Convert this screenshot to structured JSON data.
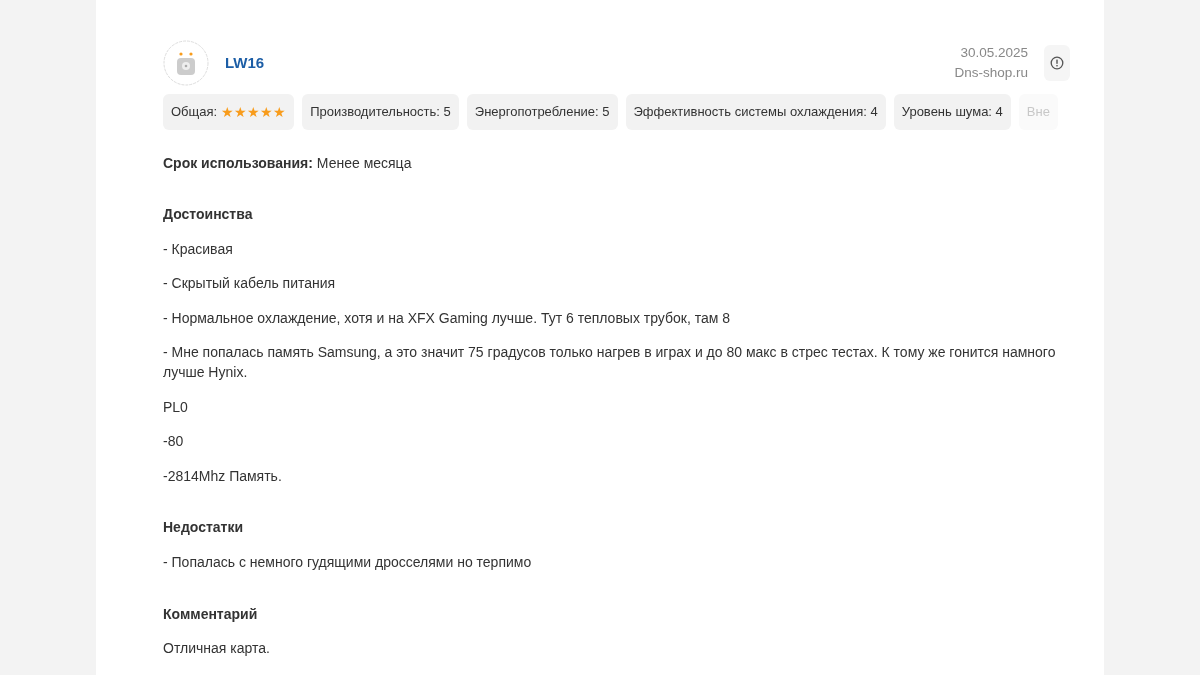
{
  "review": {
    "author": "LW16",
    "date": "30.05.2025",
    "source": "Dns-shop.ru",
    "ratings": [
      {
        "kind": "stars",
        "label": "Общая:",
        "stars": 5
      },
      {
        "kind": "text",
        "label": "Производительность: 5"
      },
      {
        "kind": "text",
        "label": "Энергопотребление: 5"
      },
      {
        "kind": "text",
        "label": "Эффективность системы охлаждения: 4"
      },
      {
        "kind": "text",
        "label": "Уровень шума: 4"
      },
      {
        "kind": "faded",
        "label": "Вне"
      }
    ],
    "usage": "**Срок использования:** Менее месяца",
    "sections": [
      {
        "title": "Достоинства",
        "lines": [
          "- Красивая",
          "- Скрытый кабель питания",
          "- Нормальное охлаждение, хотя и на XFX Gaming лучше. Тут 6 тепловых трубок, там 8",
          "- Мне попалась память Samsung, а это значит 75 градусов только нагрев в играх и до 80 макс в стрес тестах. К тому же гонится намного лучше Hynix.",
          "PL0",
          "-80",
          "-2814Mhz Память."
        ]
      },
      {
        "title": "Недостатки",
        "lines": [
          "- Попалась с немного гудящими дросселями но терпимо"
        ]
      },
      {
        "title": "Комментарий",
        "lines": [
          "Отличная карта."
        ]
      }
    ]
  }
}
